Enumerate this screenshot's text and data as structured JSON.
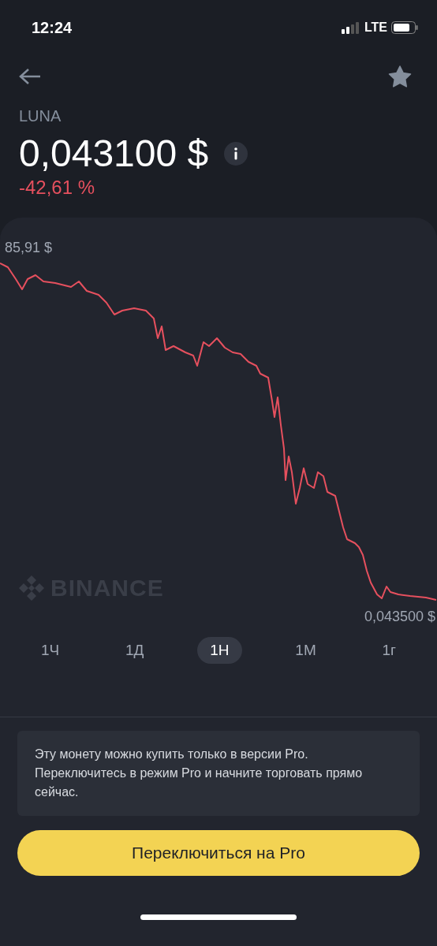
{
  "status_bar": {
    "time": "12:24",
    "network": "LTE"
  },
  "coin": {
    "symbol": "LUNA",
    "price": "0,043100 $",
    "change": "-42,61 %",
    "favorite": true
  },
  "chart": {
    "high_label": "85,91 $",
    "low_label": "0,043500 $",
    "watermark": "BINANCE"
  },
  "periods": [
    {
      "label": "1Ч",
      "selected": false
    },
    {
      "label": "1Д",
      "selected": false
    },
    {
      "label": "1Н",
      "selected": true
    },
    {
      "label": "1М",
      "selected": false
    },
    {
      "label": "1г",
      "selected": false
    }
  ],
  "notice": "Эту монету можно купить только в версии Pro. Переключитесь в режим Pro и начните торговать прямо сейчас.",
  "button": "Переключиться на Pro"
}
